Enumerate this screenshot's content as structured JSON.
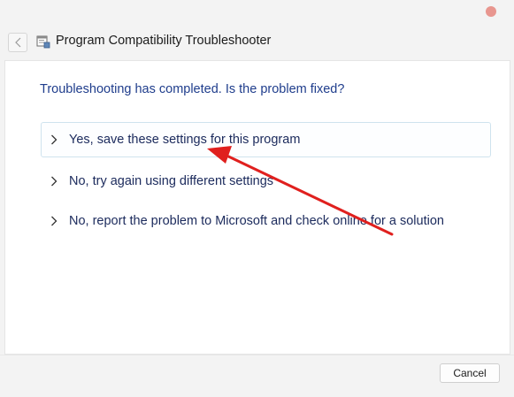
{
  "window": {
    "title": "Program Compatibility Troubleshooter"
  },
  "main": {
    "heading": "Troubleshooting has completed.  Is the problem fixed?",
    "options": [
      {
        "label": "Yes, save these settings for this program",
        "selected": true
      },
      {
        "label": "No, try again using different settings",
        "selected": false
      },
      {
        "label": "No, report the problem to Microsoft and check online for a solution",
        "selected": false
      }
    ]
  },
  "footer": {
    "cancel_label": "Cancel"
  },
  "colors": {
    "heading_text": "#1f3d8c",
    "option_text": "#1b2a5c",
    "annotation_arrow": "#e0201e",
    "selected_border": "#cfe3ee"
  },
  "icons": {
    "back": "back-arrow-icon",
    "app": "troubleshooter-icon",
    "option_chevron": "chevron-right-icon"
  }
}
